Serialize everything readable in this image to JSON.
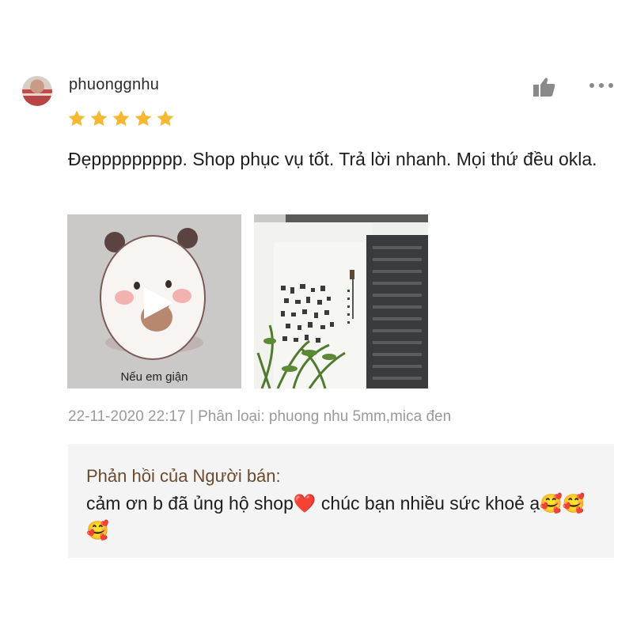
{
  "review": {
    "username": "phuonggnhu",
    "rating": 5,
    "text": "Đẹppppppppp. Shop phục vụ tốt. Trả lời nhanh. Mọi thứ đều okla.",
    "video_caption": "Nếu em giận",
    "meta": "22-11-2020 22:17 | Phân loại: phuong nhu 5mm,mica đen"
  },
  "seller_reply": {
    "title": "Phản hồi của Người bán:",
    "text": "cảm ơn b đã ủng hộ shop❤️  chúc bạn nhiều sức khoẻ ạ🥰🥰🥰"
  },
  "icons": {
    "avatar": "user-avatar",
    "like": "thumbs-up-icon",
    "more": "more-dots-icon",
    "star": "star-icon",
    "play": "play-icon"
  },
  "colors": {
    "star": "#f5b830",
    "reply_title": "#6b4a2e",
    "meta": "#9a9a9a",
    "reply_bg": "#f4f4f4"
  }
}
